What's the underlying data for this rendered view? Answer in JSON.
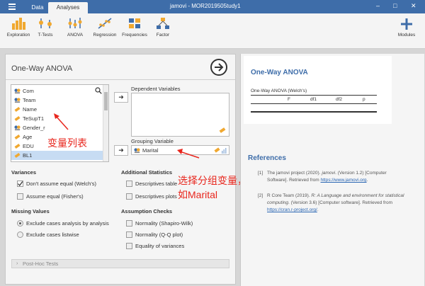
{
  "titlebar": {
    "tabs": [
      "Data",
      "Analyses"
    ],
    "title": "jamovi - MOR2019505tudy1",
    "controls": [
      "–",
      "□",
      "✕"
    ]
  },
  "ribbon": {
    "items": [
      "Exploration",
      "T-Tests",
      "ANOVA",
      "Regression",
      "Frequencies",
      "Factor"
    ],
    "modules": "Modules"
  },
  "analysis": {
    "title": "One-Way ANOVA",
    "variables": [
      "Com",
      "Team",
      "Name",
      "TeSupT1",
      "Gender_r",
      "Age",
      "EDU",
      "BL1"
    ],
    "dependent_label": "Dependent Variables",
    "grouping_label": "Grouping Variable",
    "grouping_value": "Marital",
    "arrow": "➜",
    "variances": {
      "title": "Variances",
      "options": [
        {
          "label": "Don't assume equal (Welch's)",
          "checked": true
        },
        {
          "label": "Assume equal (Fisher's)",
          "checked": false
        }
      ]
    },
    "additional": {
      "title": "Additional Statistics",
      "options": [
        {
          "label": "Descriptives table",
          "checked": false
        },
        {
          "label": "Descriptives plots",
          "checked": false
        }
      ]
    },
    "missing": {
      "title": "Missing Values",
      "options": [
        {
          "label": "Exclude cases analysis by analysis",
          "checked": true
        },
        {
          "label": "Exclude cases listwise",
          "checked": false
        }
      ]
    },
    "assumption": {
      "title": "Assumption Checks",
      "options": [
        {
          "label": "Normality (Shapiro-Wilk)",
          "checked": false
        },
        {
          "label": "Normality (Q-Q plot)",
          "checked": false
        },
        {
          "label": "Equality of variances",
          "checked": false
        }
      ]
    },
    "posthoc": "Post-Hoc Tests"
  },
  "annotations": {
    "varlist": "变量列表",
    "grouping_line1": "选择分组变量，",
    "grouping_line2": "如Marital"
  },
  "results": {
    "title": "One-Way ANOVA",
    "subtitle": "One-Way ANOVA (Welch's)",
    "columns": [
      "F",
      "df1",
      "df2",
      "p"
    ],
    "references_title": "References",
    "refs": [
      {
        "num": "[1]",
        "pre": "The jamovi project (2020). ",
        "ital": "jamovi",
        "post": ". (Version 1.2) [Computer Software]. Retrieved from ",
        "link": "https://www.jamovi.org",
        "end": "."
      },
      {
        "num": "[2]",
        "pre": "R Core Team (2019). ",
        "ital": "R: A Language and environment for statistical computing",
        "post": ". (Version 3.6) [Computer software]. Retrieved from ",
        "link": "https://cran.r-project.org/",
        "end": "."
      }
    ]
  },
  "colors": {
    "titlebar": "#3e6da9",
    "accent": "#3e6da9",
    "annotation": "#e8261d",
    "selected_row": "#c7dcf3"
  }
}
